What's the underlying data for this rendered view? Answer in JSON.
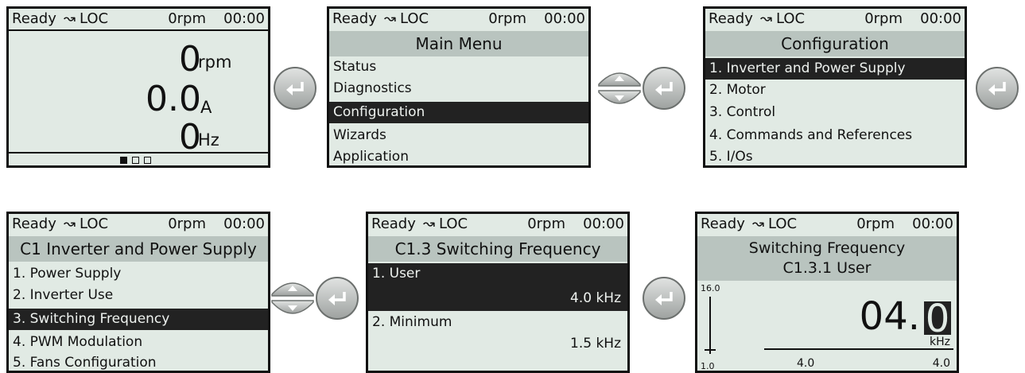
{
  "status": {
    "state": "Ready",
    "rotation_symbol": "↝",
    "mode": "LOC",
    "speed": "0rpm",
    "time": "00:00"
  },
  "s1": {
    "rpm_value": "0",
    "rpm_unit": "rpm",
    "amp_value": "0.0",
    "amp_unit": "A",
    "hz_value": "0",
    "hz_unit": "Hz"
  },
  "s2": {
    "title": "Main Menu",
    "items": [
      "Status",
      "Diagnostics",
      "Configuration",
      "Wizards",
      "Application"
    ]
  },
  "s3": {
    "title": "Configuration",
    "items": [
      "1. Inverter and Power Supply",
      "2. Motor",
      "3. Control",
      "4. Commands and References",
      "5. I/Os"
    ]
  },
  "s4": {
    "title": "C1 Inverter and Power Supply",
    "items": [
      "1. Power Supply",
      "2. Inverter Use",
      "3. Switching Frequency",
      "4. PWM Modulation",
      "5. Fans Configuration"
    ]
  },
  "s5": {
    "title": "C1.3 Switching Frequency",
    "user_label": "1. User",
    "user_value": "4.0 kHz",
    "min_label": "2. Minimum",
    "min_value": "1.5 kHz"
  },
  "s6": {
    "title_line1": "Switching Frequency",
    "title_line2": "C1.3.1 User",
    "max": "16.0",
    "min": "1.0",
    "value_main": "04.",
    "value_cursor": "0",
    "unit": "kHz",
    "default": "4.0",
    "previous": "4.0"
  },
  "colors": {
    "lcd_bg": "#e1eae4",
    "header_bg": "#b9c4bf",
    "selection_bg": "#222222"
  }
}
